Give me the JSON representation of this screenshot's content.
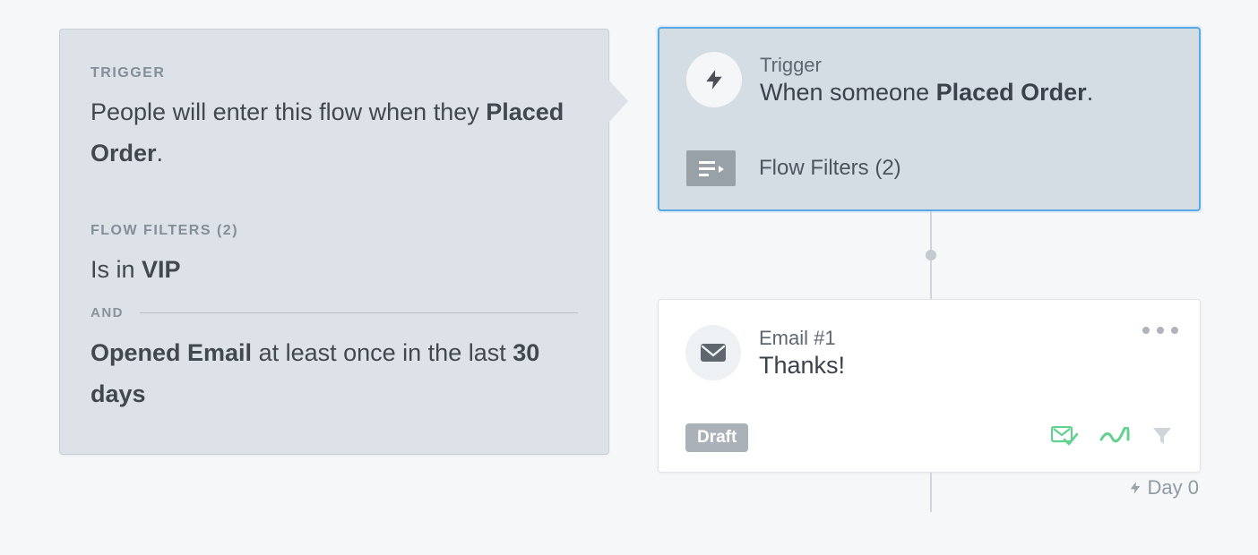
{
  "detail": {
    "trigger_label": "TRIGGER",
    "trigger_desc_prefix": "People will enter this flow when they ",
    "trigger_event": "Placed Order",
    "trigger_desc_suffix": ".",
    "filters_label": "FLOW FILTERS (2)",
    "filter1_prefix": "Is in ",
    "filter1_value": "VIP",
    "and_label": "AND",
    "filter2_event": "Opened Email",
    "filter2_mid": " at least once in the last ",
    "filter2_period": "30 days"
  },
  "trigger_card": {
    "label": "Trigger",
    "title_prefix": "When someone ",
    "title_event": "Placed Order",
    "title_suffix": ".",
    "flow_filters_label": "Flow Filters (2)"
  },
  "email_card": {
    "label": "Email #1",
    "title": "Thanks!",
    "status": "Draft"
  },
  "day_label": "Day 0"
}
